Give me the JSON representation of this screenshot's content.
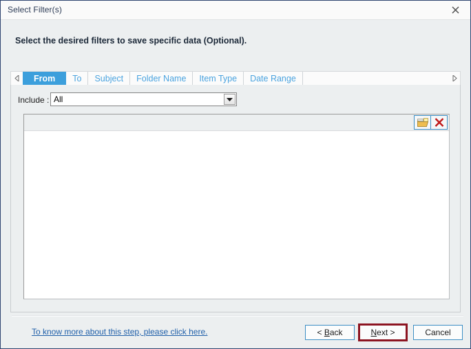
{
  "window": {
    "title": "Select Filter(s)",
    "close_icon": "close-icon"
  },
  "header": {
    "instruction": "Select the desired filters to save specific data (Optional)."
  },
  "tabstrip": {
    "scroll_left_icon": "chevron-left-icon",
    "scroll_right_icon": "chevron-right-icon",
    "tabs": [
      {
        "label": "From",
        "active": true
      },
      {
        "label": "To",
        "active": false
      },
      {
        "label": "Subject",
        "active": false
      },
      {
        "label": "Folder Name",
        "active": false
      },
      {
        "label": "Item Type",
        "active": false
      },
      {
        "label": "Date Range",
        "active": false
      }
    ]
  },
  "panel": {
    "include_label": "Include :",
    "include_value": "All",
    "include_options": [
      "All"
    ],
    "toolbar": {
      "browse_icon": "open-folder-icon",
      "delete_icon": "red-x-icon"
    },
    "list_items": []
  },
  "footer": {
    "help_link": "To know more about this step, please click here.",
    "buttons": {
      "back": {
        "prefix": "< ",
        "accel": "B",
        "rest": "ack"
      },
      "next": {
        "prefix": "",
        "accel": "N",
        "rest": "ext >"
      },
      "cancel": {
        "label": "Cancel"
      }
    }
  },
  "colors": {
    "accent_blue": "#3c9fdc",
    "tab_text_blue": "#4aa3df",
    "highlight_red": "#8c1421",
    "link_blue": "#1f5fa9",
    "window_border": "#2e4470",
    "panel_bg": "#eceff0"
  }
}
